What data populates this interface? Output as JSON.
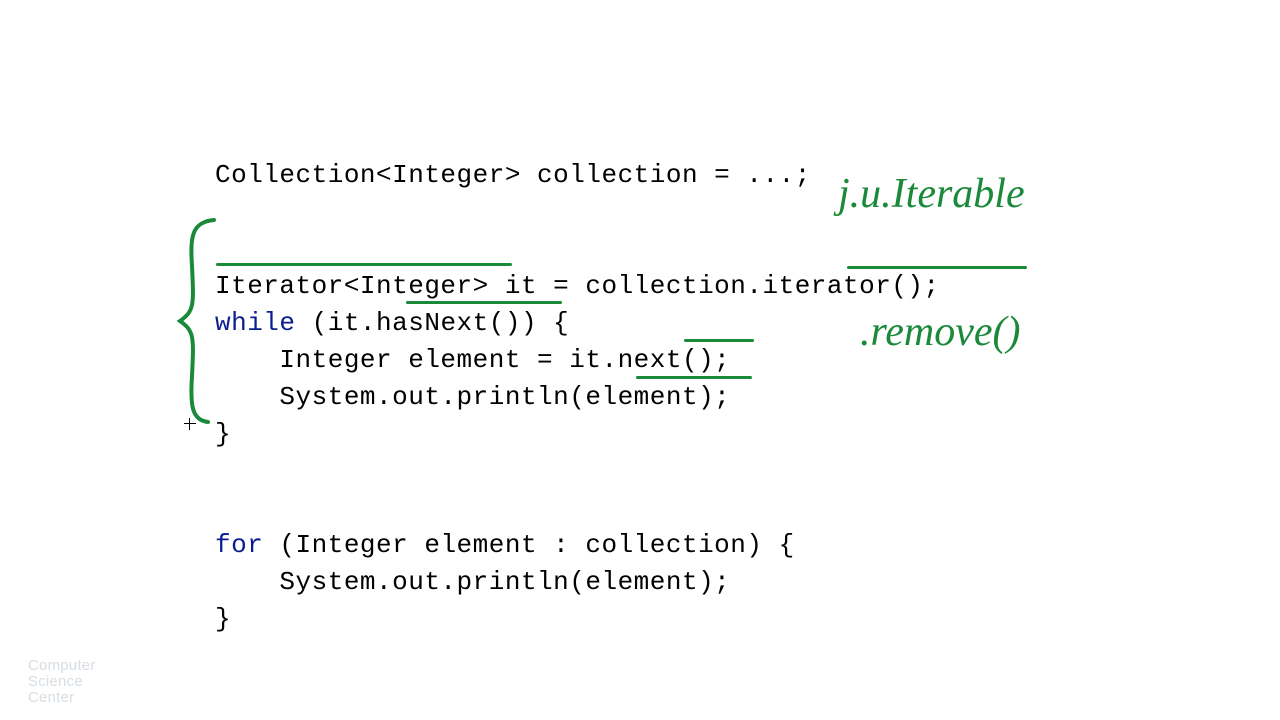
{
  "code": {
    "line1_a": "Collection<Integer> collection = ...;",
    "line3_a": "Iterator<Integer> it = collection.iterator();",
    "line4_kw": "while",
    "line4_rest": " (it.hasNext()) {",
    "line5": "    Integer element = it.next();",
    "line6": "    System.out.println(element);",
    "line7": "}",
    "line9_kw": "for",
    "line9_rest": " (Integer element : collection) {",
    "line10": "    System.out.println(element);",
    "line11": "}"
  },
  "annotations": {
    "iterable": "j.u.Iterable",
    "remove": ".remove()"
  },
  "logo": {
    "l1": "Computer",
    "l2": "Science",
    "l3": "Center"
  }
}
